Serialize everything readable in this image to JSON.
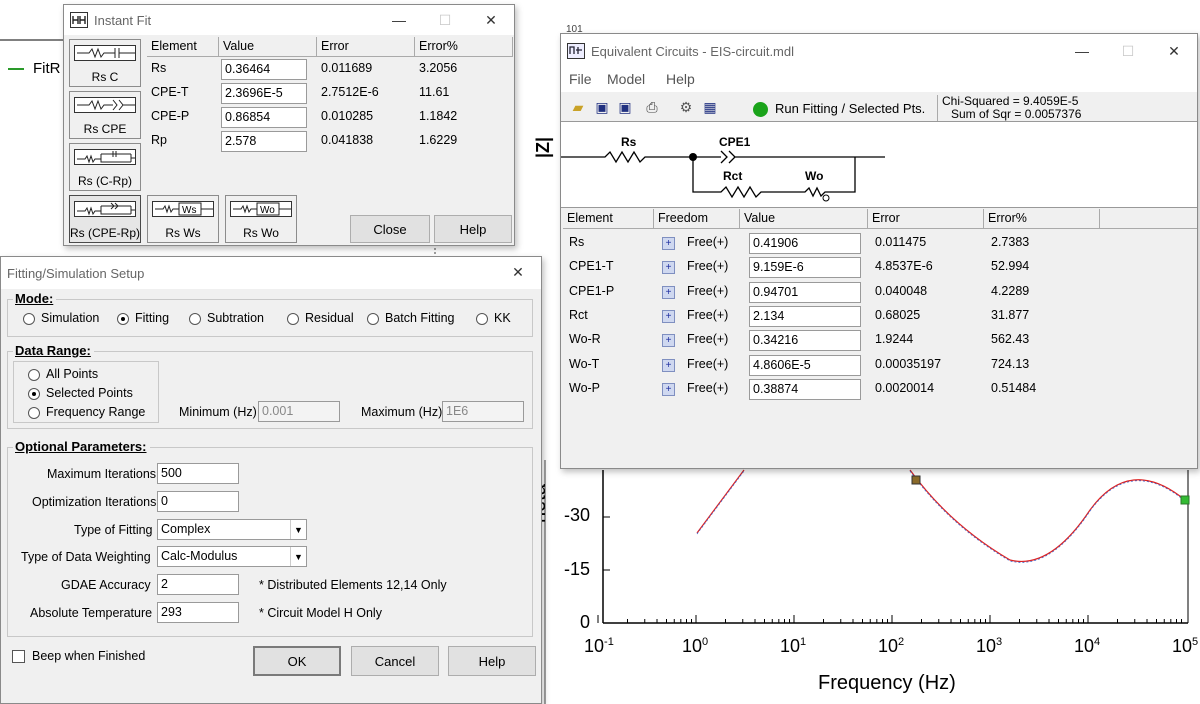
{
  "background_plot": {
    "legend_label": "FitR",
    "y_axis_label_top": "|Z|",
    "y_axis_label_bottom": "heta",
    "y_ticks": [
      "-30",
      "-15",
      "0"
    ],
    "x_axis_label": "Frequency (Hz)",
    "x_ticks": [
      {
        "base": "10",
        "exp": "-1"
      },
      {
        "base": "10",
        "exp": "0"
      },
      {
        "base": "10",
        "exp": "1"
      },
      {
        "base": "10",
        "exp": "2"
      },
      {
        "base": "10",
        "exp": "3"
      },
      {
        "base": "10",
        "exp": "4"
      },
      {
        "base": "10",
        "exp": "5"
      }
    ],
    "top_fragment": "101"
  },
  "instant_fit": {
    "title": "Instant Fit",
    "element_buttons": [
      {
        "label": "Rs C",
        "icon": "rs-c-circuit-icon"
      },
      {
        "label": "Rs CPE",
        "icon": "rs-cpe-circuit-icon"
      },
      {
        "label": "Rs (C-Rp)",
        "icon": "rs-c-rp-circuit-icon"
      },
      {
        "label": "Rs (CPE-Rp)",
        "icon": "rs-cpe-rp-circuit-icon"
      },
      {
        "label": "Rs Ws",
        "icon": "rs-ws-circuit-icon"
      },
      {
        "label": "Rs Wo",
        "icon": "rs-wo-circuit-icon"
      }
    ],
    "columns": [
      "Element",
      "Value",
      "Error",
      "Error%"
    ],
    "rows": [
      {
        "element": "Rs",
        "value": "0.36464",
        "error": "0.011689",
        "error_pct": "3.2056"
      },
      {
        "element": "CPE-T",
        "value": "2.3696E-5",
        "error": "2.7512E-6",
        "error_pct": "11.61"
      },
      {
        "element": "CPE-P",
        "value": "0.86854",
        "error": "0.010285",
        "error_pct": "1.1842"
      },
      {
        "element": "Rp",
        "value": "2.578",
        "error": "0.041838",
        "error_pct": "1.6229"
      }
    ],
    "close_label": "Close",
    "help_label": "Help"
  },
  "fitting_setup": {
    "title": "Fitting/Simulation Setup",
    "mode_title": "Mode:",
    "mode_options": [
      "Simulation",
      "Fitting",
      "Subtration",
      "Residual",
      "Batch Fitting",
      "KK"
    ],
    "mode_selected": "Fitting",
    "data_range_title": "Data Range:",
    "range_options": [
      "All Points",
      "Selected Points",
      "Frequency Range"
    ],
    "range_selected": "Selected Points",
    "min_label": "Minimum (Hz)",
    "min_value": "0.001",
    "max_label": "Maximum (Hz)",
    "max_value": "1E6",
    "optional_title": "Optional Parameters:",
    "max_iter_label": "Maximum Iterations",
    "max_iter_value": "500",
    "opt_iter_label": "Optimization Iterations",
    "opt_iter_value": "0",
    "fit_type_label": "Type of Fitting",
    "fit_type_value": "Complex",
    "weighting_label": "Type of Data Weighting",
    "weighting_value": "Calc-Modulus",
    "gdae_label": "GDAE Accuracy",
    "gdae_value": "2",
    "gdae_note": "* Distributed Elements 12,14 Only",
    "temp_label": "Absolute Temperature",
    "temp_value": "293",
    "temp_note": "* Circuit Model H Only",
    "beep_label": "Beep when Finished",
    "beep_checked": false,
    "ok_label": "OK",
    "cancel_label": "Cancel",
    "help_label": "Help"
  },
  "equiv_circuits": {
    "title": "Equivalent Circuits - EIS-circuit.mdl",
    "menu": [
      "File",
      "Model",
      "Help"
    ],
    "run_label": "Run Fitting / Selected Pts.",
    "chi_squared": "Chi-Squared = 9.4059E-5",
    "sum_sqr": "Sum of Sqr = 0.0057376",
    "circuit_labels": {
      "rs": "Rs",
      "cpe": "CPE1",
      "rct": "Rct",
      "wo": "Wo"
    },
    "columns": [
      "Element",
      "Freedom",
      "Value",
      "Error",
      "Error%"
    ],
    "rows": [
      {
        "element": "Rs",
        "freedom": "Free(+)",
        "value": "0.41906",
        "error": "0.011475",
        "error_pct": "2.7383"
      },
      {
        "element": "CPE1-T",
        "freedom": "Free(+)",
        "value": "9.159E-6",
        "error": "4.8537E-6",
        "error_pct": "52.994"
      },
      {
        "element": "CPE1-P",
        "freedom": "Free(+)",
        "value": "0.94701",
        "error": "0.040048",
        "error_pct": "4.2289"
      },
      {
        "element": "Rct",
        "freedom": "Free(+)",
        "value": "2.134",
        "error": "0.68025",
        "error_pct": "31.877"
      },
      {
        "element": "Wo-R",
        "freedom": "Free(+)",
        "value": "0.34216",
        "error": "1.9244",
        "error_pct": "562.43"
      },
      {
        "element": "Wo-T",
        "freedom": "Free(+)",
        "value": "4.8606E-5",
        "error": "0.00035197",
        "error_pct": "724.13"
      },
      {
        "element": "Wo-P",
        "freedom": "Free(+)",
        "value": "0.38874",
        "error": "0.0020014",
        "error_pct": "0.51484"
      }
    ],
    "run_indicator_color": "#1aa31a"
  }
}
